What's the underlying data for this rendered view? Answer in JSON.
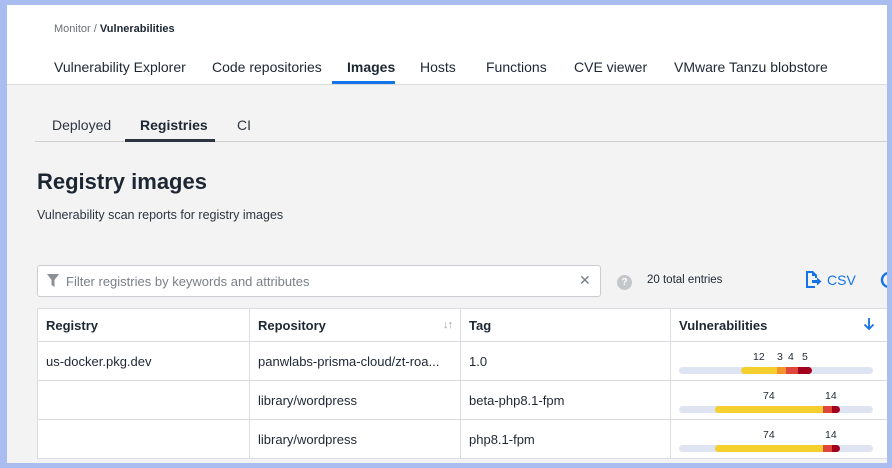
{
  "breadcrumb": {
    "parent": "Monitor",
    "separator": " / ",
    "current": "Vulnerabilities"
  },
  "main_tabs": [
    {
      "label": "Vulnerability Explorer",
      "active": false
    },
    {
      "label": "Code repositories",
      "active": false
    },
    {
      "label": "Images",
      "active": true
    },
    {
      "label": "Hosts",
      "active": false
    },
    {
      "label": "Functions",
      "active": false
    },
    {
      "label": "CVE viewer",
      "active": false
    },
    {
      "label": "VMware Tanzu blobstore",
      "active": false
    }
  ],
  "sub_tabs": [
    {
      "label": "Deployed",
      "active": false
    },
    {
      "label": "Registries",
      "active": true
    },
    {
      "label": "CI",
      "active": false
    }
  ],
  "page": {
    "title": "Registry images",
    "subtitle": "Vulnerability scan reports for registry images"
  },
  "filter": {
    "placeholder": "Filter registries by keywords and attributes",
    "value": ""
  },
  "total_entries": "20 total entries",
  "csv_label": "CSV",
  "table": {
    "columns": [
      "Registry",
      "Repository",
      "Tag",
      "Vulnerabilities"
    ],
    "rows": [
      {
        "registry": "us-docker.pkg.dev",
        "repository": "panwlabs-prisma-cloud/zt-roa...",
        "tag": "1.0",
        "vuln_labels": [
          "12",
          "3",
          "4",
          "5"
        ],
        "vuln_segments": [
          {
            "value": 12,
            "color": "#f5cf2e"
          },
          {
            "value": 3,
            "color": "#f2932b"
          },
          {
            "value": 4,
            "color": "#e0473c"
          },
          {
            "value": 5,
            "color": "#a3001e"
          }
        ]
      },
      {
        "registry": "",
        "repository": "library/wordpress",
        "tag": "beta-php8.1-fpm",
        "vuln_labels": [
          "74",
          "14"
        ],
        "vuln_segments": [
          {
            "value": 74,
            "color": "#f5cf2e"
          },
          {
            "value": 0,
            "color": "#f2932b"
          },
          {
            "value": 14,
            "color": "#e0473c"
          },
          {
            "value": 0,
            "color": "#a3001e"
          }
        ]
      },
      {
        "registry": "",
        "repository": "library/wordpress",
        "tag": "php8.1-fpm",
        "vuln_labels": [
          "74",
          "14"
        ],
        "vuln_segments": [
          {
            "value": 74,
            "color": "#f5cf2e"
          },
          {
            "value": 0,
            "color": "#f2932b"
          },
          {
            "value": 14,
            "color": "#e0473c"
          },
          {
            "value": 0,
            "color": "#a3001e"
          }
        ]
      }
    ]
  },
  "colors": {
    "accent": "#1473e6",
    "low": "#f5cf2e",
    "medium": "#f2932b",
    "high": "#e0473c",
    "critical": "#a3001e"
  }
}
